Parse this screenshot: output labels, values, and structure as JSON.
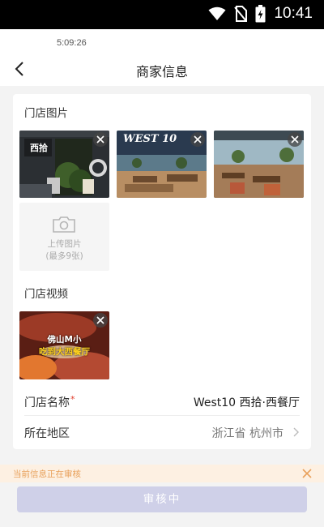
{
  "status_bar": {
    "time": "10:41"
  },
  "nav": {
    "clock": "5:09:26",
    "title": "商家信息"
  },
  "store_images": {
    "label": "门店图片",
    "items": [
      {
        "sign_text": "西拾"
      },
      {
        "sign_text": "WEST 10"
      },
      {
        "sign_text": ""
      }
    ],
    "upload": {
      "line1": "上传图片",
      "line2": "(最多9张)"
    }
  },
  "store_video": {
    "label": "门店视频",
    "overlay_line1": "佛山M小",
    "overlay_line2": "吃到大西餐厅"
  },
  "store_name": {
    "label": "门店名称",
    "required_mark": "*",
    "value": "West10 西拾·西餐厅"
  },
  "region": {
    "label": "所在地区",
    "value": "浙江省 杭州市"
  },
  "notice": {
    "text": "当前信息正在审核"
  },
  "submit": {
    "label": "审核中"
  },
  "colors": {
    "notice_bg": "#fdf0e2",
    "notice_text": "#e8a05a",
    "button_disabled": "#cfd0e8",
    "required": "#e0402f"
  }
}
